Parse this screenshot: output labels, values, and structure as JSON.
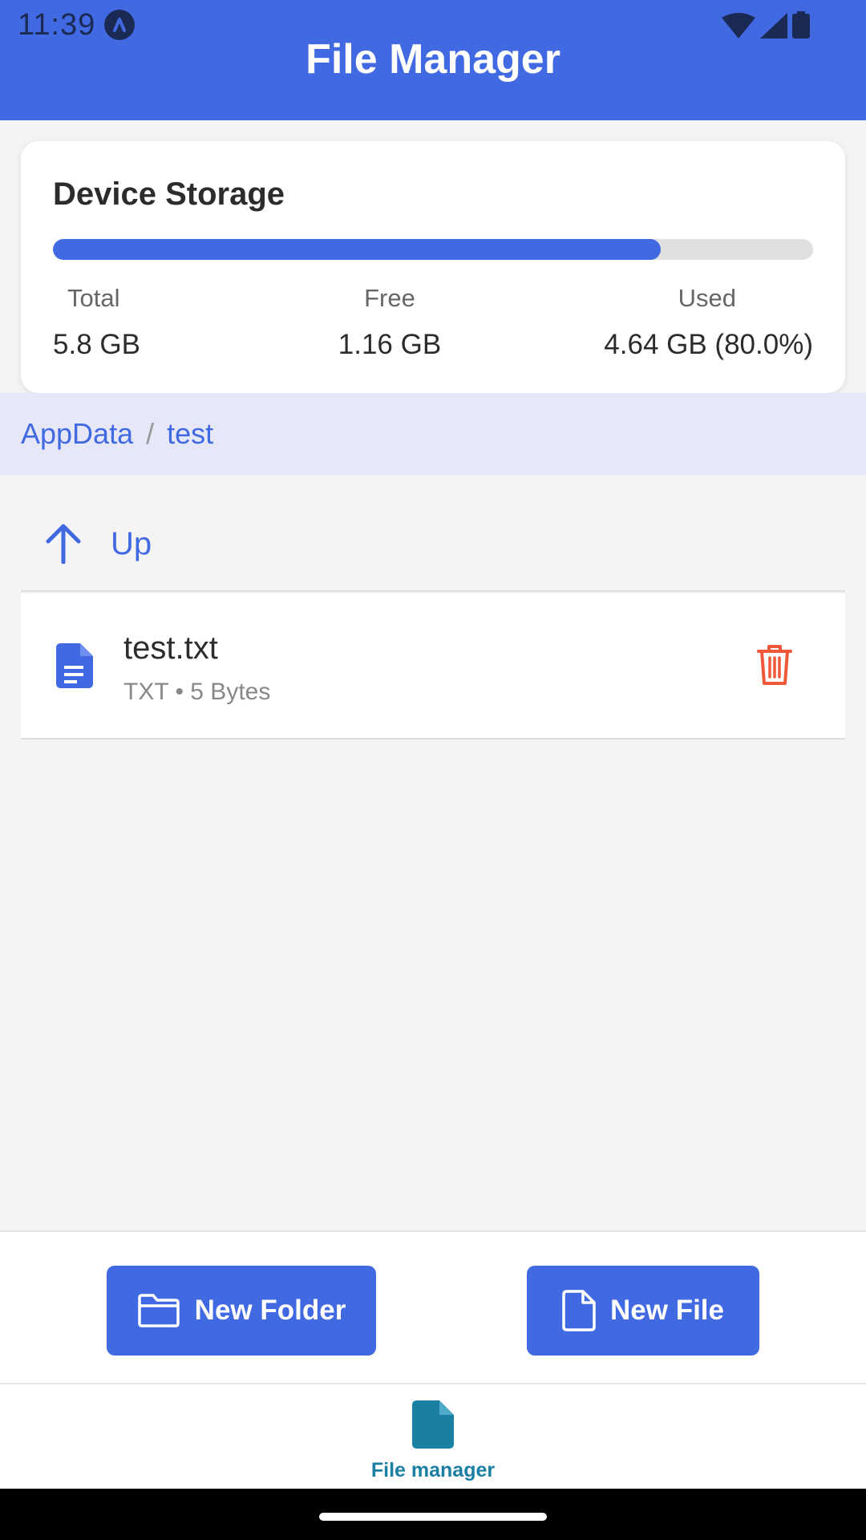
{
  "status_bar": {
    "time": "11:39",
    "icons": [
      "wifi-icon",
      "cell-signal-icon",
      "battery-icon"
    ]
  },
  "header": {
    "title": "File Manager",
    "background_color": "#4169e1"
  },
  "storage": {
    "title": "Device Storage",
    "used_fraction": 0.8,
    "total_label": "Total",
    "total_value": "5.8 GB",
    "free_label": "Free",
    "free_value": "1.16 GB",
    "used_label": "Used",
    "used_value": "4.64 GB (80.0%)"
  },
  "breadcrumb": {
    "items": [
      "AppData",
      "test"
    ],
    "separator": "/"
  },
  "up_row": {
    "label": "Up",
    "icon": "arrow-up-icon"
  },
  "files": [
    {
      "name": "test.txt",
      "meta": "TXT • 5 Bytes",
      "icon": "document-icon",
      "action_icon": "trash-icon"
    }
  ],
  "actions": {
    "new_folder": "New Folder",
    "new_file": "New File"
  },
  "bottom_nav": {
    "items": [
      {
        "label": "File manager",
        "icon": "file-icon",
        "active": true
      }
    ],
    "active_color": "#1a7fa3"
  },
  "colors": {
    "accent": "#4169e1",
    "danger": "#f0583a"
  }
}
